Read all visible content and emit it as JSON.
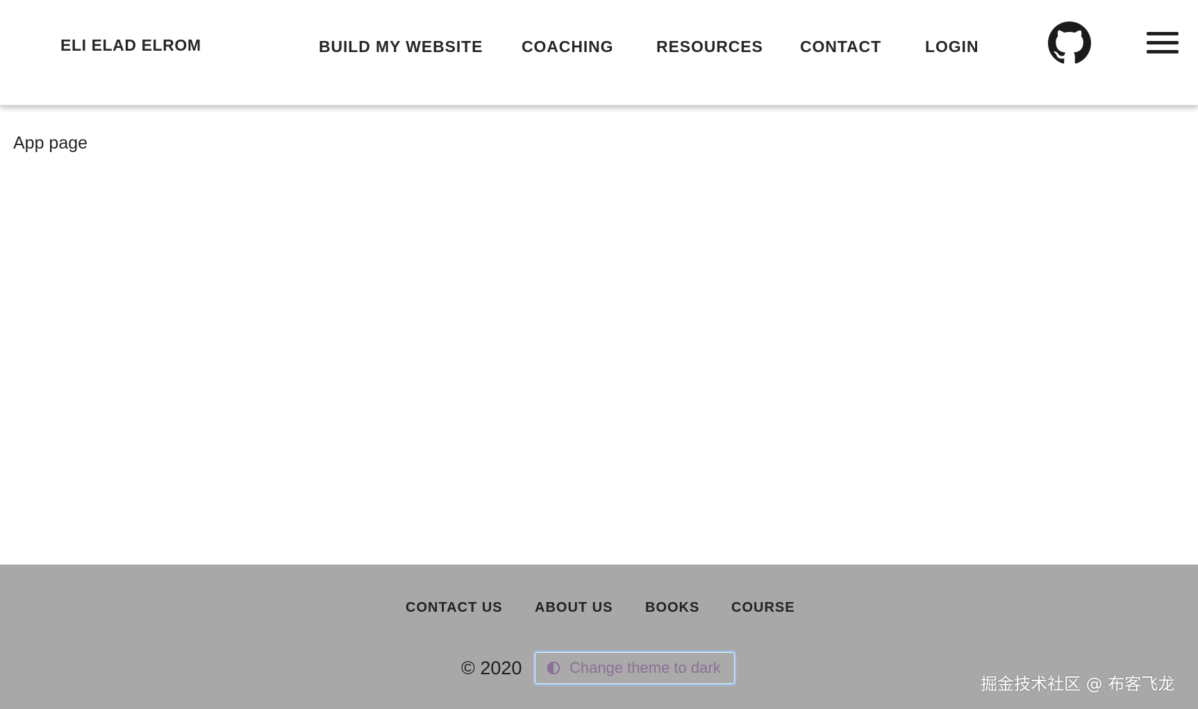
{
  "header": {
    "brand": "ELI ELAD ELROM",
    "nav": [
      {
        "label": "BUILD MY WEBSITE"
      },
      {
        "label": "COACHING"
      },
      {
        "label": "RESOURCES"
      },
      {
        "label": "CONTACT"
      },
      {
        "label": "LOGIN"
      }
    ],
    "icons": {
      "github": "github-icon",
      "menu": "hamburger-menu-icon"
    }
  },
  "main": {
    "title": "App page"
  },
  "footer": {
    "links": [
      {
        "label": "CONTACT US"
      },
      {
        "label": "ABOUT US"
      },
      {
        "label": "BOOKS"
      },
      {
        "label": "COURSE"
      }
    ],
    "copyright": "© 2020",
    "theme_button": {
      "label": "Change theme to dark",
      "icon": "half-drop-icon"
    },
    "watermark": "掘金技术社区 @ 布客飞龙"
  },
  "colors": {
    "header_bg": "#ffffff",
    "footer_bg": "#a8a8a8",
    "text": "#222222",
    "theme_button_text": "#8a6f96",
    "theme_button_border": "#9cc3f0"
  }
}
